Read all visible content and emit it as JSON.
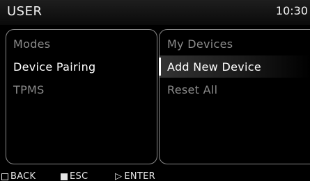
{
  "header": {
    "title": "USER",
    "clock": "10:30"
  },
  "left_menu": {
    "items": [
      {
        "label": "Modes",
        "state": "dim"
      },
      {
        "label": "Device Pairing",
        "state": "active"
      },
      {
        "label": "TPMS",
        "state": "dim"
      }
    ]
  },
  "right_menu": {
    "items": [
      {
        "label": "My Devices",
        "state": "dim"
      },
      {
        "label": "Add New Device",
        "state": "selected"
      },
      {
        "label": "Reset All",
        "state": "dim"
      }
    ]
  },
  "footer": {
    "back": {
      "label": "BACK",
      "icon": "square-outline-icon"
    },
    "esc": {
      "label": "ESC",
      "icon": "square-filled-icon"
    },
    "enter": {
      "label": "ENTER",
      "icon": "triangle-right-icon"
    }
  }
}
